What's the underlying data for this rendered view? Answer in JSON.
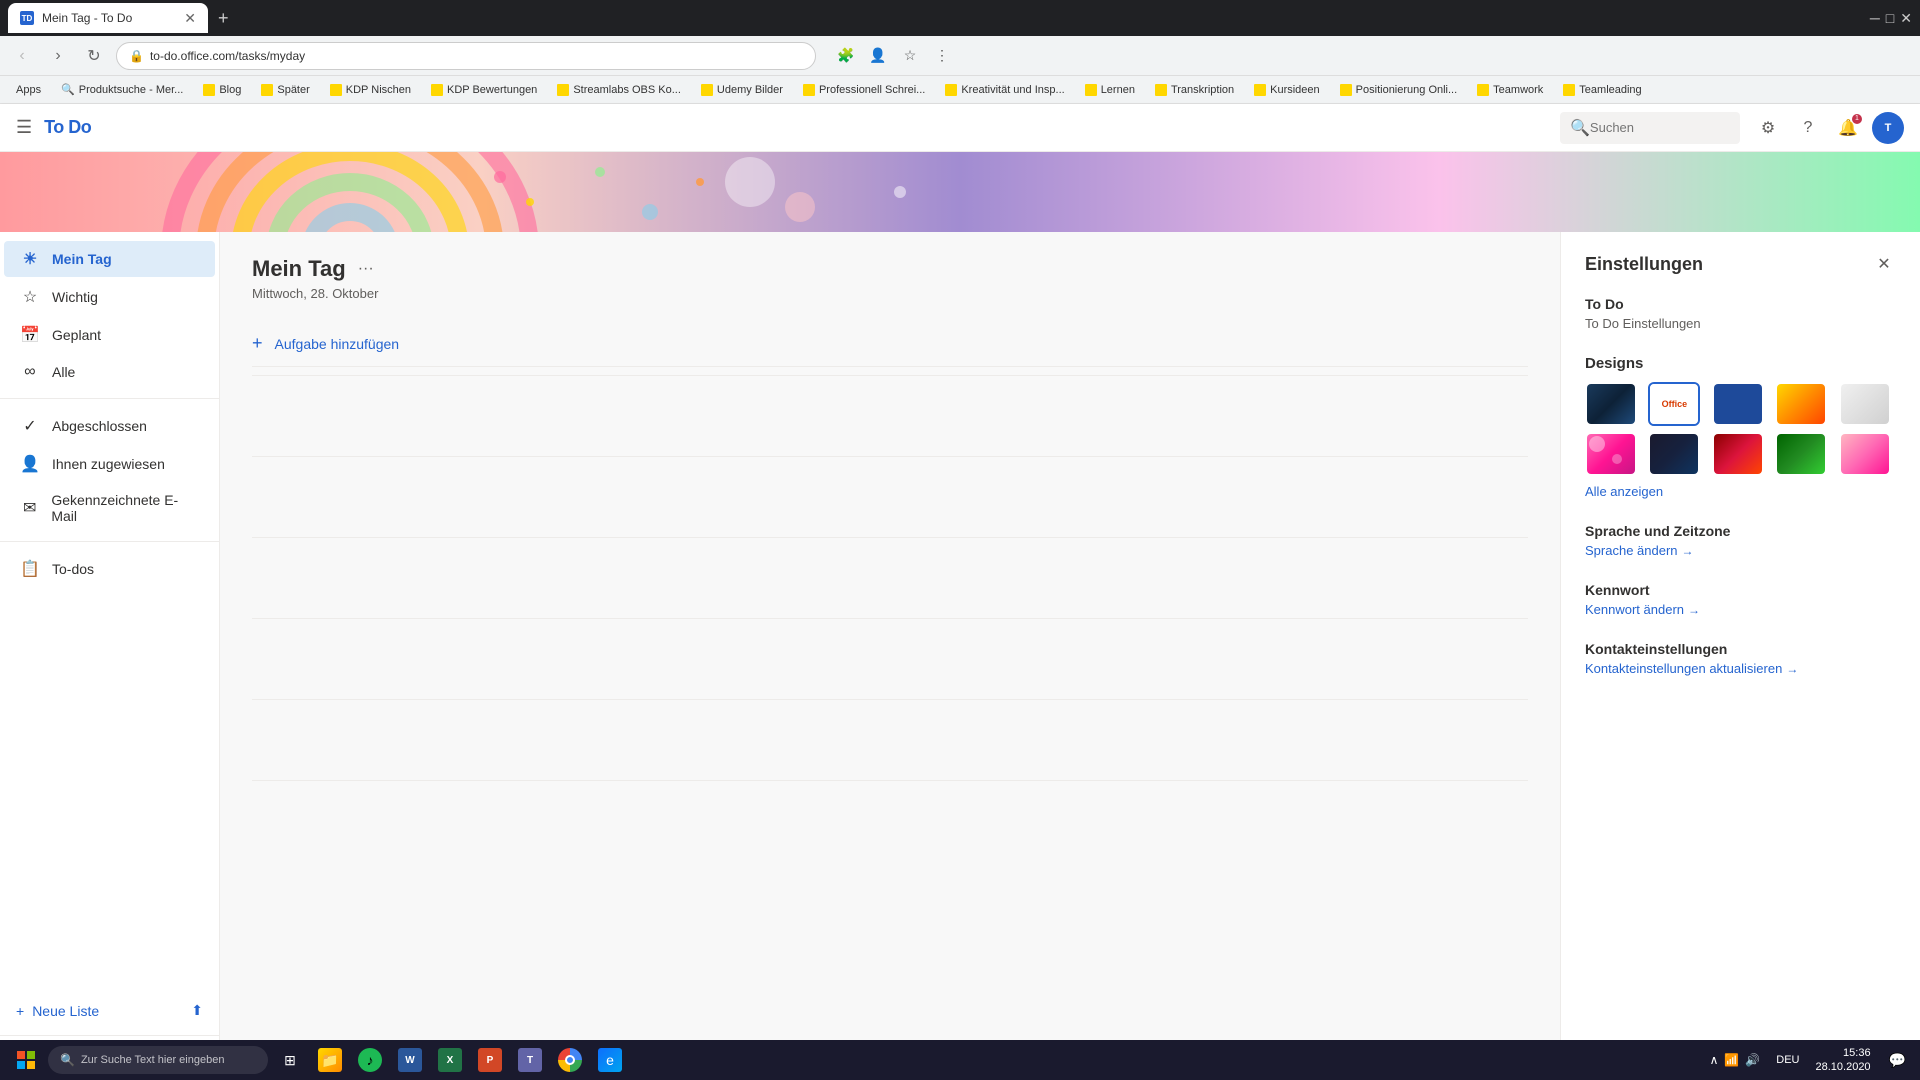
{
  "browser": {
    "tab_title": "Mein Tag - To Do",
    "tab_favicon": "TD",
    "url": "to-do.office.com/tasks/myday",
    "new_tab_symbol": "+"
  },
  "bookmarks": {
    "apps_label": "Apps",
    "items": [
      {
        "label": "Produktsuche - Mer...",
        "folder": false
      },
      {
        "label": "Blog",
        "folder": true
      },
      {
        "label": "Später",
        "folder": true
      },
      {
        "label": "KDP Nischen",
        "folder": true
      },
      {
        "label": "KDP Bewertungen",
        "folder": true
      },
      {
        "label": "Streamlabs OBS Ko...",
        "folder": true
      },
      {
        "label": "Udemy Bilder",
        "folder": true
      },
      {
        "label": "Professionell Schrei...",
        "folder": true
      },
      {
        "label": "Kreativität und Insp...",
        "folder": true
      },
      {
        "label": "Lernen",
        "folder": true
      },
      {
        "label": "Transkription",
        "folder": true
      },
      {
        "label": "Kursideen",
        "folder": true
      },
      {
        "label": "Positionierung Onli...",
        "folder": true
      },
      {
        "label": "Teamwork",
        "folder": true
      },
      {
        "label": "Teamleading",
        "folder": true
      }
    ]
  },
  "topbar": {
    "app_name": "To Do",
    "search_placeholder": "Suchen",
    "notification_count": "1",
    "avatar_initials": "T"
  },
  "sidebar": {
    "items": [
      {
        "id": "mein-tag",
        "label": "Mein Tag",
        "icon": "☀️",
        "active": true
      },
      {
        "id": "wichtig",
        "label": "Wichtig",
        "icon": "⭐",
        "active": false
      },
      {
        "id": "geplant",
        "label": "Geplant",
        "icon": "📅",
        "active": false
      },
      {
        "id": "alle",
        "label": "Alle",
        "icon": "∞",
        "active": false
      },
      {
        "id": "abgeschlossen",
        "label": "Abgeschlossen",
        "icon": "✓",
        "active": false
      },
      {
        "id": "ihnen-zugewiesen",
        "label": "Ihnen zugewiesen",
        "icon": "👤",
        "active": false
      },
      {
        "id": "gekennzeichnete-email",
        "label": "Gekennzeichnete E-Mail",
        "icon": "✉",
        "active": false
      },
      {
        "id": "to-dos",
        "label": "To-dos",
        "icon": "📋",
        "active": false
      }
    ],
    "new_list_label": "Neue Liste",
    "bottom_icons": [
      "✉",
      "📋",
      "👤",
      "✓"
    ]
  },
  "content": {
    "title": "Mein Tag",
    "date": "Mittwoch, 28. Oktober",
    "add_task_label": "Aufgabe hinzufügen"
  },
  "settings": {
    "panel_title": "Einstellungen",
    "sections": {
      "todo": {
        "title": "To Do",
        "subtitle": "To Do Einstellungen"
      },
      "designs": {
        "title": "Designs",
        "show_all_label": "Alle anzeigen",
        "thumbnails": [
          {
            "id": "dark-blue",
            "style": "dark-blue",
            "selected": false,
            "label": "Dunkelblau"
          },
          {
            "id": "office",
            "style": "office",
            "selected": true,
            "label": "Office"
          },
          {
            "id": "blue-solid",
            "style": "blue-solid",
            "selected": false,
            "label": "Blau"
          },
          {
            "id": "gradient-warm",
            "style": "gradient-warm",
            "selected": false,
            "label": "Warm"
          },
          {
            "id": "light-gray",
            "style": "light-gray",
            "selected": false,
            "label": "Hell"
          },
          {
            "id": "pink",
            "style": "pink",
            "selected": false,
            "label": "Pink"
          },
          {
            "id": "dark-wave",
            "style": "dark-wave",
            "selected": false,
            "label": "Dunkelwelle"
          },
          {
            "id": "red-pattern",
            "style": "red-pattern",
            "selected": false,
            "label": "Rot"
          },
          {
            "id": "green-pattern",
            "style": "green-pattern",
            "selected": false,
            "label": "Grün"
          },
          {
            "id": "pink-fade",
            "style": "pink-fade",
            "selected": false,
            "label": "Pink-Verlauf"
          }
        ]
      },
      "language": {
        "title": "Sprache und Zeitzone",
        "link_label": "Sprache ändern"
      },
      "password": {
        "title": "Kennwort",
        "link_label": "Kennwort ändern"
      },
      "contact": {
        "title": "Kontakteinstellungen",
        "link_label": "Kontakteinstellungen aktualisieren"
      }
    }
  },
  "taskbar": {
    "search_placeholder": "Zur Suche Text hier eingeben",
    "time": "15:36",
    "date": "28.10.2020",
    "language": "DEU"
  }
}
